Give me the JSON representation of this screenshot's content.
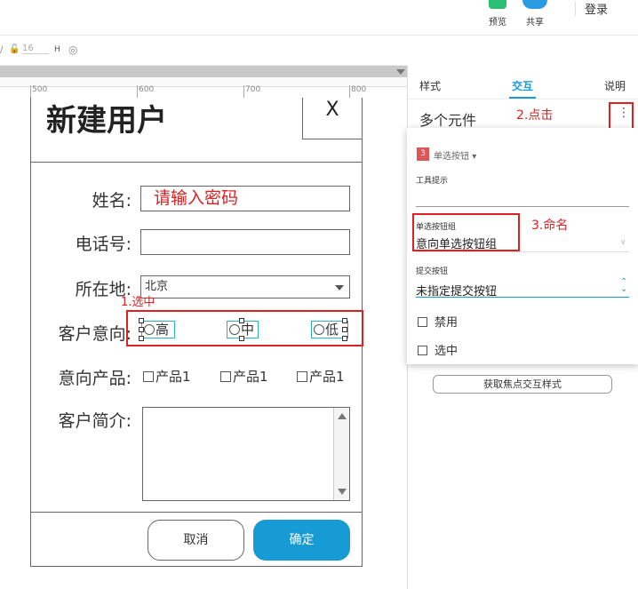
{
  "topbar": {
    "preview_label": "预览",
    "share_label": "共享",
    "login_label": "登录"
  },
  "toolbar2": {
    "height_value": "16",
    "h_label": "H"
  },
  "ruler": {
    "ticks": [
      "500",
      "600",
      "700",
      "800"
    ]
  },
  "form": {
    "title": "新建用户",
    "close_label": "X",
    "name_label": "姓名:",
    "name_value": "请输入密码",
    "phone_label": "电话号:",
    "city_label": "所在地:",
    "city_value": "北京",
    "intent_label": "客户意向:",
    "intent_options": [
      "高",
      "中",
      "低"
    ],
    "product_label": "意向产品:",
    "product_options": [
      "产品1",
      "产品1",
      "产品1"
    ],
    "intro_label": "客户简介:",
    "cancel_label": "取消",
    "confirm_label": "确定"
  },
  "annotations": {
    "step1": "1.选中",
    "step2": "2.点击",
    "step3": "3.命名"
  },
  "panel": {
    "tabs": [
      "样式",
      "交互",
      "说明"
    ],
    "active_tab": "交互",
    "title": "多个元件",
    "popup": {
      "badge": "3",
      "type_label": "单选按钮",
      "tooltip_label": "工具提示",
      "group_label": "单选按钮组",
      "group_value": "意向单选按钮组",
      "submit_label": "提交按钮",
      "submit_value": "未指定提交按钮",
      "disable_label": "禁用",
      "selected_label": "选中"
    },
    "focus_button": "获取焦点交互样式"
  }
}
